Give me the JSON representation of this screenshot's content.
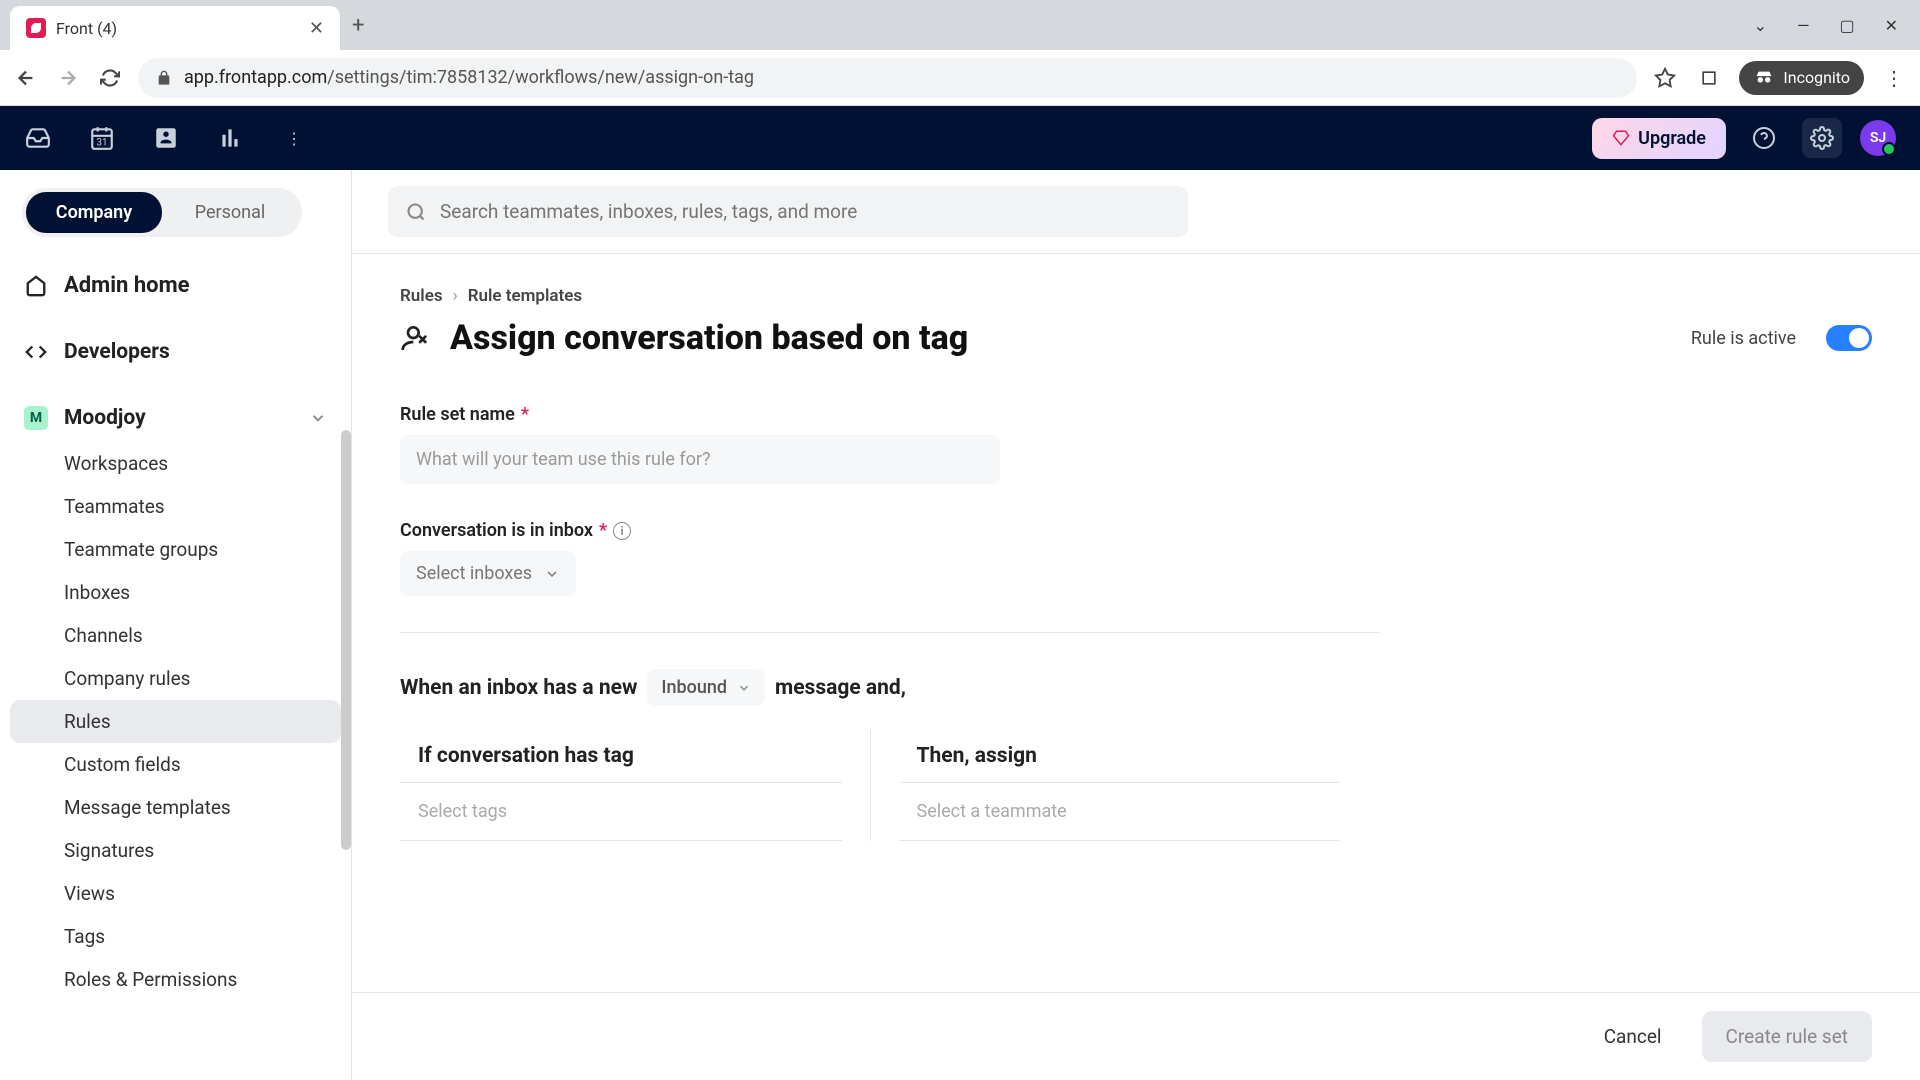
{
  "browser": {
    "tab_title": "Front (4)",
    "url_host": "app.frontapp.com",
    "url_path": "/settings/tim:7858132/workflows/new/assign-on-tag",
    "incognito_label": "Incognito"
  },
  "header": {
    "upgrade_label": "Upgrade",
    "avatar_initials": "SJ"
  },
  "sidebar": {
    "scope_company": "Company",
    "scope_personal": "Personal",
    "admin_home": "Admin home",
    "developers": "Developers",
    "team_name": "Moodjoy",
    "team_initial": "M",
    "subitems": [
      "Workspaces",
      "Teammates",
      "Teammate groups",
      "Inboxes",
      "Channels",
      "Company rules",
      "Rules",
      "Custom fields",
      "Message templates",
      "Signatures",
      "Views",
      "Tags",
      "Roles & Permissions"
    ],
    "active_index": 6
  },
  "search": {
    "placeholder": "Search teammates, inboxes, rules, tags, and more"
  },
  "breadcrumb": {
    "rules": "Rules",
    "templates": "Rule templates"
  },
  "page": {
    "title": "Assign conversation based on tag",
    "toggle_label": "Rule is active",
    "rule_name_label": "Rule set name",
    "rule_name_placeholder": "What will your team use this rule for?",
    "inbox_label": "Conversation is in inbox",
    "inbox_select": "Select inboxes",
    "when_prefix": "When an inbox has a new",
    "when_direction": "Inbound",
    "when_suffix": "message and,",
    "if_header": "If conversation has tag",
    "then_header": "Then, assign",
    "if_placeholder": "Select tags",
    "then_placeholder": "Select a teammate"
  },
  "footer": {
    "cancel": "Cancel",
    "create": "Create rule set"
  }
}
